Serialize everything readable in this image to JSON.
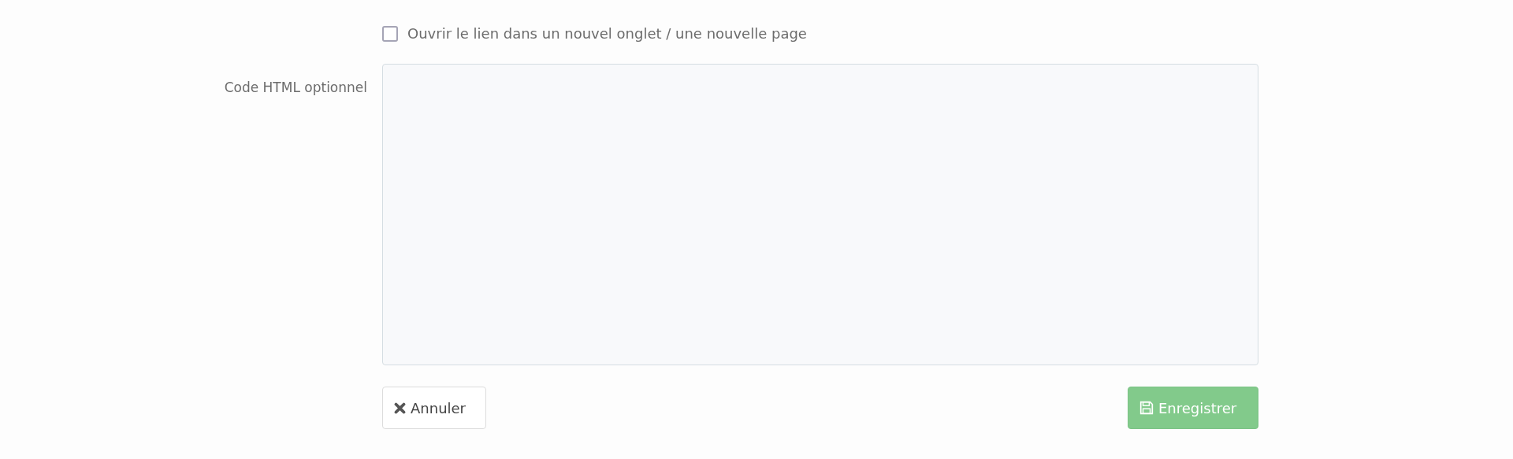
{
  "new_tab_checkbox": {
    "label": "Ouvrir le lien dans un nouvel onglet / une nouvelle page",
    "checked": false
  },
  "html_code": {
    "label": "Code HTML optionnel"
  },
  "buttons": [
    {
      "kind": "cancel",
      "label": "Annuler"
    },
    {
      "kind": "save",
      "label": "Enregistrer"
    }
  ]
}
